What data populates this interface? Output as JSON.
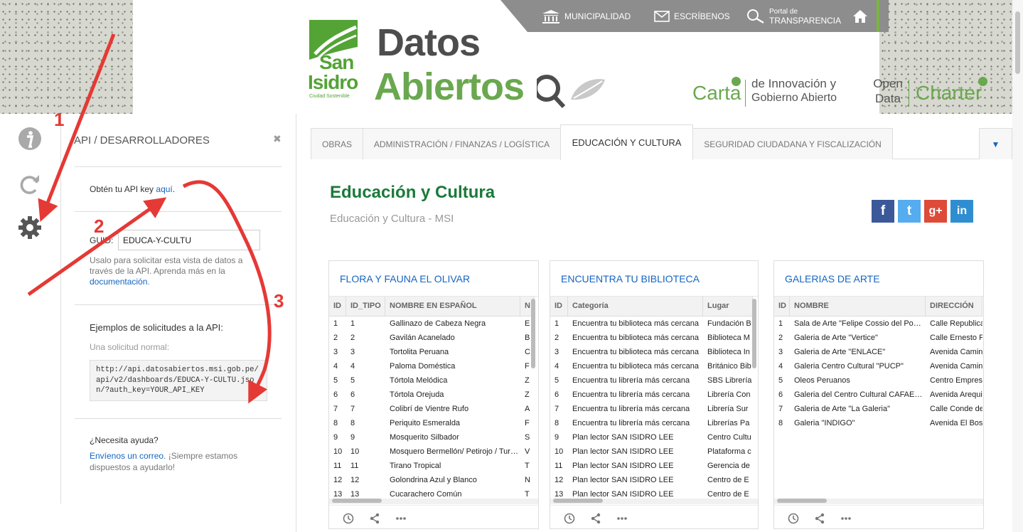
{
  "header": {
    "topnav": {
      "municipalidad": "MUNICIPALIDAD",
      "escribenos": "ESCRÍBENOS",
      "portal_small": "Portal de",
      "portal_big": "TRANSPARENCIA"
    },
    "logo": {
      "san": "San",
      "isidro": "Isidro",
      "tagline": "Ciudad Sostenible"
    },
    "brand": {
      "line1": "Datos",
      "line2": "Abiertos"
    },
    "carta": {
      "word": "Carta",
      "line1": "de Innovación y",
      "line2": "Gobierno Abierto"
    },
    "charter": {
      "line1": "Open",
      "line2": "Data",
      "word": "Charter"
    }
  },
  "api_panel": {
    "title": "API / DESARROLLADORES",
    "close": "✖",
    "key_prefix": "Obtén tu API key ",
    "key_link": "aquí",
    "key_suffix": ".",
    "guid_label": "GUID:",
    "guid_value": "EDUCA-Y-CULTU",
    "guid_help": "Usalo para solicitar esta vista de datos a través de la API. Aprenda más en la ",
    "guid_help_link": "documentación",
    "guid_help_suffix": ".",
    "examples_title": "Ejemplos de solicitudes a la API:",
    "examples_sub": "Una solicitud normal:",
    "example_url": "http://api.datosabiertos.msi.gob.pe/api/v2/dashboards/EDUCA-Y-CULTU.json/?auth_key=YOUR_API_KEY",
    "help_title": "¿Necesita ayuda?",
    "help_link": "Envíenos un correo",
    "help_text": ". ¡Siempre estamos dispuestos a ayudarlo!"
  },
  "annotations": {
    "n1": "1",
    "n2": "2",
    "n3": "3"
  },
  "tabs": [
    {
      "label": "OBRAS"
    },
    {
      "label": "ADMINISTRACIÓN / FINANZAS / LOGÍSTICA"
    },
    {
      "label": "EDUCACIÓN Y CULTURA"
    },
    {
      "label": "SEGURIDAD CIUDADANA Y FISCALIZACIÓN"
    },
    {
      "label": "▼"
    }
  ],
  "section": {
    "title": "Educación y Cultura",
    "subtitle": "Educación y Cultura - MSI"
  },
  "social": {
    "fb": "f",
    "tw": "t",
    "gp": "g+",
    "in": "in"
  },
  "cards": [
    {
      "title": "FLORA Y FAUNA EL OLIVAR",
      "columns": [
        "ID",
        "ID_TIPO",
        "NOMBRE EN ESPAÑOL",
        "N"
      ],
      "rows": [
        [
          "1",
          "1",
          "Gallinazo de Cabeza Negra",
          "E"
        ],
        [
          "2",
          "2",
          "Gavilán Acanelado",
          "B"
        ],
        [
          "3",
          "3",
          "Tortolita Peruana",
          "C"
        ],
        [
          "4",
          "4",
          "Paloma Doméstica",
          "F"
        ],
        [
          "5",
          "5",
          "Tórtola Melódica",
          "Z"
        ],
        [
          "6",
          "6",
          "Tórtola Orejuda",
          "Z"
        ],
        [
          "7",
          "7",
          "Colibrí de Vientre Rufo",
          "A"
        ],
        [
          "8",
          "8",
          "Periquito Esmeralda",
          "F"
        ],
        [
          "9",
          "9",
          "Mosquerito Silbador",
          "S"
        ],
        [
          "10",
          "10",
          "Mosquero Bermellón/ Petirojo / Tur…",
          "V"
        ],
        [
          "11",
          "11",
          "Tirano Tropical",
          "T"
        ],
        [
          "12",
          "12",
          "Golondrina Azul y Blanco",
          "N"
        ],
        [
          "13",
          "13",
          "Cucarachero Común",
          "T"
        ]
      ]
    },
    {
      "title": "ENCUENTRA TU BIBLIOTECA",
      "columns": [
        "ID",
        "Categoría",
        "Lugar"
      ],
      "rows": [
        [
          "1",
          "Encuentra tu biblioteca más cercana",
          "Fundación B"
        ],
        [
          "2",
          "Encuentra tu biblioteca más cercana",
          "Biblioteca M"
        ],
        [
          "3",
          "Encuentra tu biblioteca más cercana",
          "Biblioteca In"
        ],
        [
          "4",
          "Encuentra tu biblioteca más cercana",
          "Británico Bib"
        ],
        [
          "5",
          "Encuentra tu librería más cercana",
          "SBS Librería"
        ],
        [
          "6",
          "Encuentra tu librería más cercana",
          "Librería Con"
        ],
        [
          "7",
          "Encuentra tu librería más cercana",
          "Librería Sur"
        ],
        [
          "8",
          "Encuentra tu librería más cercana",
          "Librerías Pa"
        ],
        [
          "9",
          "Plan lector SAN ISIDRO LEE",
          "Centro Cultu"
        ],
        [
          "10",
          "Plan lector SAN ISIDRO LEE",
          "Plataforma c"
        ],
        [
          "11",
          "Plan lector SAN ISIDRO LEE",
          "Gerencia de"
        ],
        [
          "12",
          "Plan lector SAN ISIDRO LEE",
          "Centro de E"
        ],
        [
          "13",
          "Plan lector SAN ISIDRO LEE",
          "Centro de E"
        ]
      ]
    },
    {
      "title": "GALERIAS DE ARTE",
      "columns": [
        "ID",
        "NOMBRE",
        "DIRECCIÓN"
      ],
      "rows": [
        [
          "1",
          "Sala de Arte \"Felipe Cossio del Po…",
          "Calle Republica"
        ],
        [
          "2",
          "Galeria de Arte \"Vertice\"",
          "Calle Ernesto P"
        ],
        [
          "3",
          "Galeria de Arte \"ENLACE\"",
          "Avenida Camino"
        ],
        [
          "4",
          "Galeria Centro Cultural \"PUCP\"",
          "Avenida Camino"
        ],
        [
          "5",
          "Oleos Peruanos",
          "Centro Empresa"
        ],
        [
          "6",
          "Galeria del Centro Cultural CAFAE…",
          "Avenida Arequip"
        ],
        [
          "7",
          "Galeria de Arte \"La Galeria\"",
          "Calle Conde de"
        ],
        [
          "8",
          "Galeria \"INDIGO\"",
          "Avenida El Bosq"
        ]
      ]
    }
  ]
}
